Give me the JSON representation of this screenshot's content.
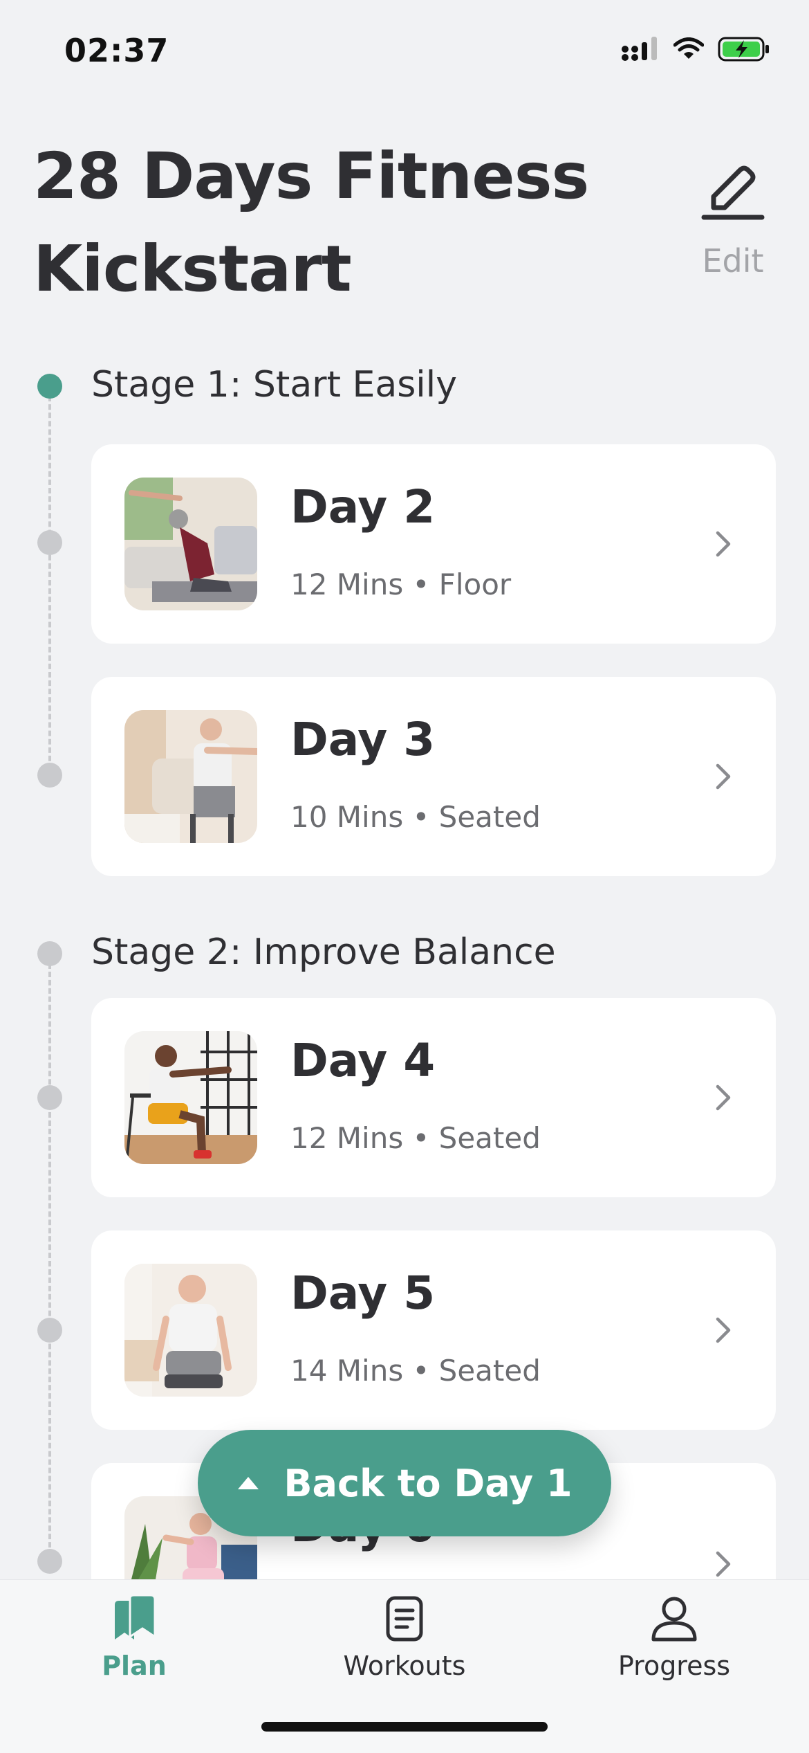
{
  "status_bar": {
    "time": "02:37"
  },
  "header": {
    "title_line1": "28 Days Fitness",
    "title_line2": "Kickstart",
    "edit_label": "Edit"
  },
  "stages": [
    {
      "title": "Stage 1: Start Easily"
    },
    {
      "title": "Stage 2: Improve Balance"
    }
  ],
  "days": [
    {
      "title": "Day 2",
      "subtitle": "12 Mins • Floor"
    },
    {
      "title": "Day 3",
      "subtitle": "10 Mins • Seated"
    },
    {
      "title": "Day 4",
      "subtitle": "12 Mins • Seated"
    },
    {
      "title": "Day 5",
      "subtitle": "14 Mins • Seated"
    },
    {
      "title": "Day 6",
      "subtitle": ""
    }
  ],
  "fab": {
    "label": "Back to Day 1"
  },
  "tabs": [
    {
      "label": "Plan",
      "icon": "bookmarks-icon",
      "active": true
    },
    {
      "label": "Workouts",
      "icon": "document-icon",
      "active": false
    },
    {
      "label": "Progress",
      "icon": "person-icon",
      "active": false
    }
  ],
  "colors": {
    "accent": "#4a9e8c",
    "background": "#f1f2f4",
    "card": "#ffffff",
    "muted": "#a3a4a8"
  }
}
